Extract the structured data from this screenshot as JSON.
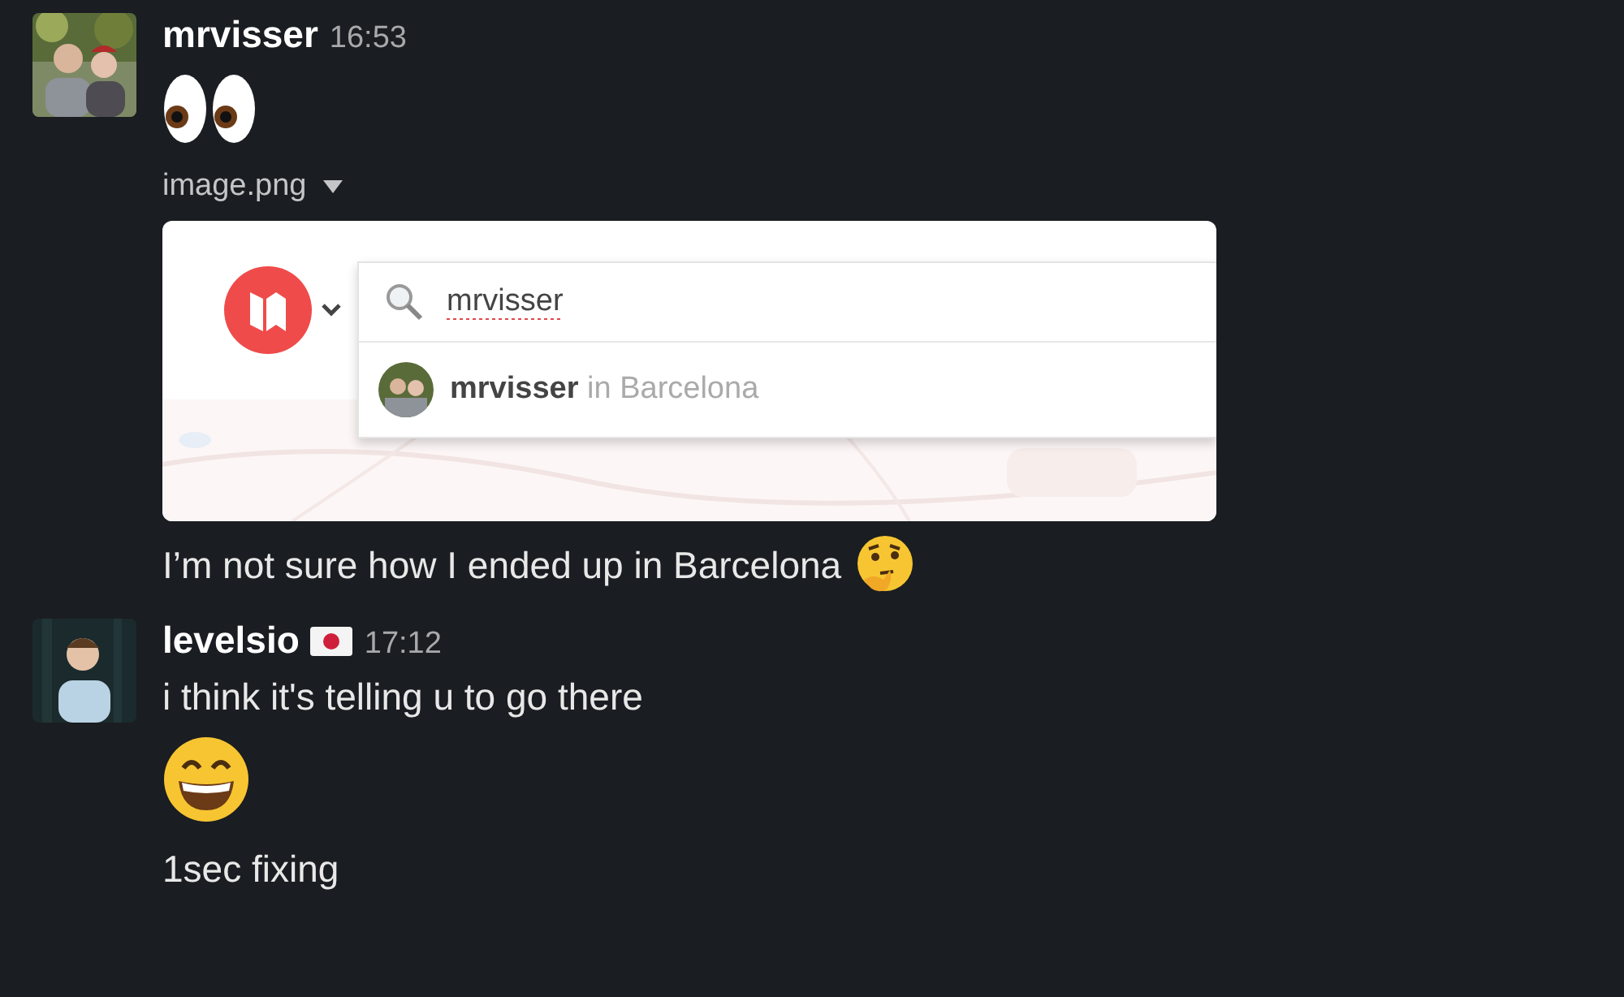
{
  "messages": [
    {
      "author": "mrvisser",
      "status_flag": false,
      "time": "16:53",
      "blocks": [
        {
          "kind": "emoji"
        },
        {
          "kind": "attachment",
          "filename": "image.png",
          "search": {
            "value": "mrvisser",
            "misspelled": true
          },
          "result": "**mrvisser** in Barcelona"
        },
        {
          "kind": "text",
          "text": "I’m not sure how I ended up in Barcelona",
          "emoji_after": true
        }
      ]
    },
    {
      "author": "levelsio",
      "status_flag": true,
      "time": "17:12",
      "blocks": [
        {
          "kind": "text",
          "text": "i think it's telling u to go there",
          "emoji_after": false
        },
        {
          "kind": "emoji"
        },
        {
          "kind": "text",
          "text": "1sec fixing",
          "emoji_after": false
        }
      ]
    }
  ]
}
